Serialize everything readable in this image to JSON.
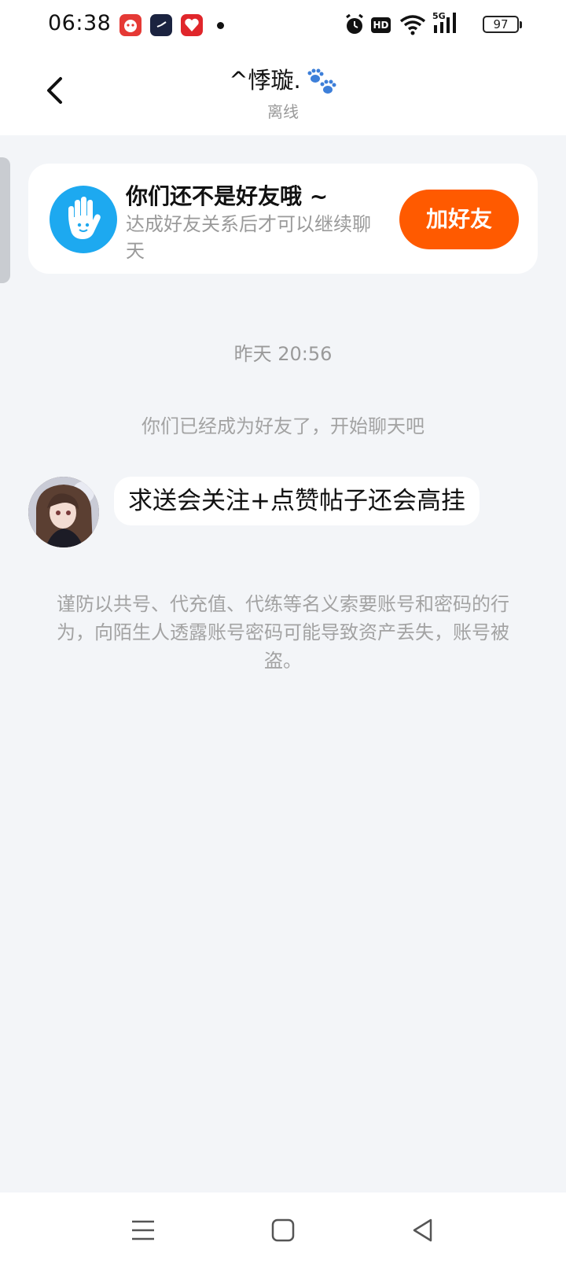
{
  "status_bar": {
    "time": "06:38",
    "app_icons": [
      "red-panda-app-icon",
      "clock-app-icon",
      "shopping-app-icon"
    ],
    "indicators": [
      "alarm-icon",
      "hd-icon",
      "wifi-icon",
      "5g-signal-icon"
    ],
    "hd_label": "HD",
    "network_label": "5G",
    "battery": "97"
  },
  "header": {
    "back_icon": "chevron-left-icon",
    "title": "^悸璇.",
    "title_emoji": "paw-prints-icon",
    "status": "离线"
  },
  "friend_card": {
    "icon": "waving-hand-icon",
    "title": "你们还不是好友哦 ~",
    "description": "达成好友关系后才可以继续聊天",
    "button_label": "加好友",
    "accent_color": "#ff5a00",
    "icon_color": "#1da9f0"
  },
  "chat": {
    "timestamp": "昨天 20:56",
    "system_message": "你们已经成为好友了，开始聊天吧",
    "messages": [
      {
        "sender": "other",
        "avatar": "anime-girl-avatar",
        "text": "求送会关注+点赞帖子还会高挂"
      }
    ],
    "warning": "谨防以共号、代充值、代练等名义索要账号和密码的行为，向陌生人透露账号密码可能导致资产丢失，账号被盗。"
  },
  "nav_bar": {
    "items": [
      "menu-icon",
      "home-square-icon",
      "back-triangle-icon"
    ]
  }
}
